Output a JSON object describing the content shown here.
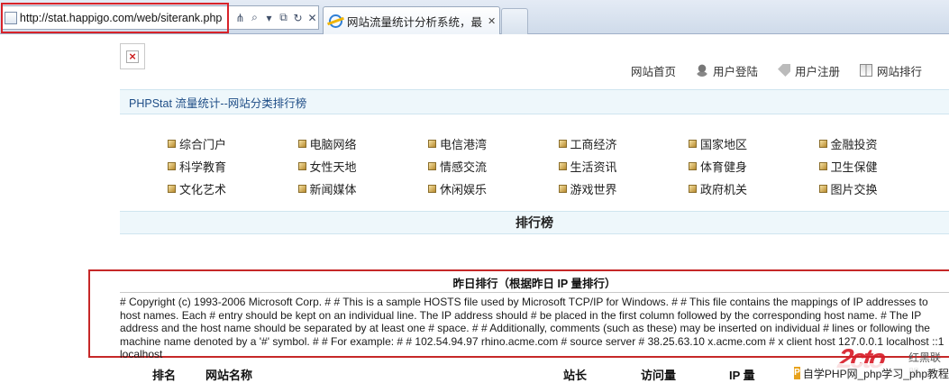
{
  "browser": {
    "url": "http://stat.happigo.com/web/siterank.php",
    "tab_title": "网站流量统计分析系统，最...",
    "tools": [
      "⋔",
      "⌕",
      "▾",
      "⧉",
      "↻",
      "✕"
    ],
    "tab_close": "✕"
  },
  "page": {
    "top_nav": [
      {
        "label": "网站首页",
        "icon": ""
      },
      {
        "label": "用户登陆",
        "icon": "user-icon"
      },
      {
        "label": "用户注册",
        "icon": "tag-icon"
      },
      {
        "label": "网站排行",
        "icon": "grid-icon"
      }
    ],
    "section_title": "PHPStat 流量统计--网站分类排行榜",
    "categories": [
      [
        "综合门户",
        "电脑网络",
        "电信港湾",
        "工商经济",
        "国家地区",
        "金融投资"
      ],
      [
        "科学教育",
        "女性天地",
        "情感交流",
        "生活资讯",
        "体育健身",
        "卫生保健"
      ],
      [
        "文化艺术",
        "新闻媒体",
        "休闲娱乐",
        "游戏世界",
        "政府机关",
        "图片交换"
      ]
    ],
    "rank_title": "排行榜",
    "yesterday_title": "昨日排行（根据昨日  IP 量排行）",
    "hosts_text": "# Copyright (c) 1993-2006 Microsoft Corp. # # This is a sample HOSTS file used by Microsoft TCP/IP for Windows. # # This file contains the mappings of IP addresses to host names. Each # entry should be kept on an individual line. The IP address should # be placed in the first column followed by the corresponding host name. # The IP address and the host name should be separated by at least one # space. # # Additionally, comments (such as these) may be inserted on individual # lines or following the machine name denoted by a '#' symbol. # # For example: # # 102.54.94.97 rhino.acme.com # source server # 38.25.63.10 x.acme.com # x client host 127.0.0.1 localhost ::1 localhost",
    "table_headers": [
      "排名",
      "网站名称",
      "站长",
      "访问量",
      "IP 量"
    ]
  },
  "watermark": {
    "logo": "2cto",
    "site_name": "红黑联盟",
    "strip_icon": "P",
    "strip_text": "自学PHP网_php学习_php教程"
  },
  "colors": {
    "highlight_red": "#d8232a",
    "bar_bg": "#eef7fb",
    "title_blue": "#1f4e87"
  }
}
